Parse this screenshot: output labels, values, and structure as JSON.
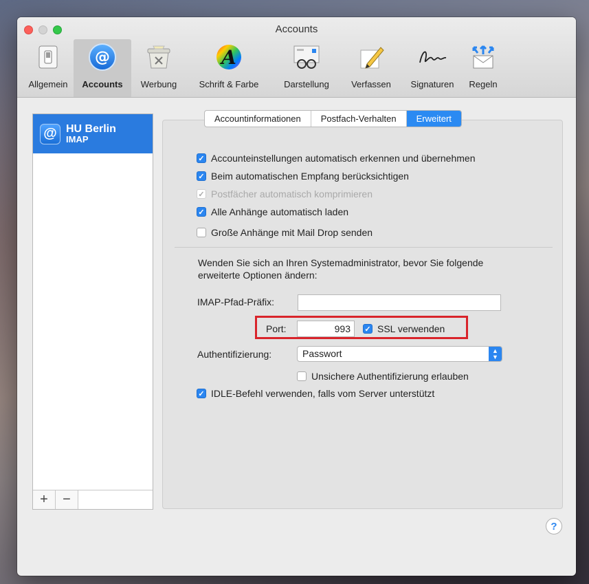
{
  "window": {
    "title": "Accounts"
  },
  "toolbar": {
    "items": [
      {
        "label": "Allgemein",
        "icon": "switch-icon"
      },
      {
        "label": "Accounts",
        "icon": "at-sign-icon"
      },
      {
        "label": "Werbung",
        "icon": "junk-mail-icon"
      },
      {
        "label": "Schrift & Farbe",
        "icon": "font-color-icon"
      },
      {
        "label": "Darstellung",
        "icon": "glasses-icon"
      },
      {
        "label": "Verfassen",
        "icon": "pencil-icon"
      },
      {
        "label": "Signaturen",
        "icon": "signature-icon"
      },
      {
        "label": "Regeln",
        "icon": "rules-envelope-icon"
      }
    ],
    "active": "Accounts"
  },
  "sidebar": {
    "accounts": [
      {
        "name": "HU Berlin",
        "type": "IMAP",
        "icon": "@"
      }
    ],
    "add_label": "+",
    "remove_label": "−"
  },
  "tabs": {
    "items": [
      "Accountinformationen",
      "Postfach-Verhalten",
      "Erweitert"
    ],
    "active": "Erweitert"
  },
  "options": {
    "auto_detect": {
      "label": "Accounteinstellungen automatisch erkennen und übernehmen",
      "checked": true
    },
    "include_auto_fetch": {
      "label": "Beim automatischen Empfang berücksichtigen",
      "checked": true
    },
    "compact_mailboxes": {
      "label": "Postfächer automatisch komprimieren",
      "checked": true,
      "disabled": true
    },
    "download_attachments": {
      "label": "Alle Anhänge automatisch laden",
      "checked": true
    },
    "mail_drop": {
      "label": "Große Anhänge mit Mail Drop senden",
      "checked": false
    }
  },
  "advanced": {
    "note": "Wenden Sie sich an Ihren Systemadministrator, bevor Sie folgende erweiterte Optionen ändern:",
    "imap_prefix_label": "IMAP-Pfad-Präfix:",
    "imap_prefix_value": "",
    "port_label": "Port:",
    "port_value": "993",
    "ssl_label": "SSL verwenden",
    "ssl_checked": true,
    "auth_label": "Authentifizierung:",
    "auth_value": "Passwort",
    "insecure_auth_label": "Unsichere Authentifizierung erlauben",
    "insecure_auth_checked": false,
    "idle_label": "IDLE-Befehl verwenden, falls vom Server unterstützt",
    "idle_checked": true
  },
  "help_label": "?",
  "colors": {
    "accent": "#2b86f0",
    "highlight_box": "#d9242b",
    "selection": "#2a7bdf"
  }
}
